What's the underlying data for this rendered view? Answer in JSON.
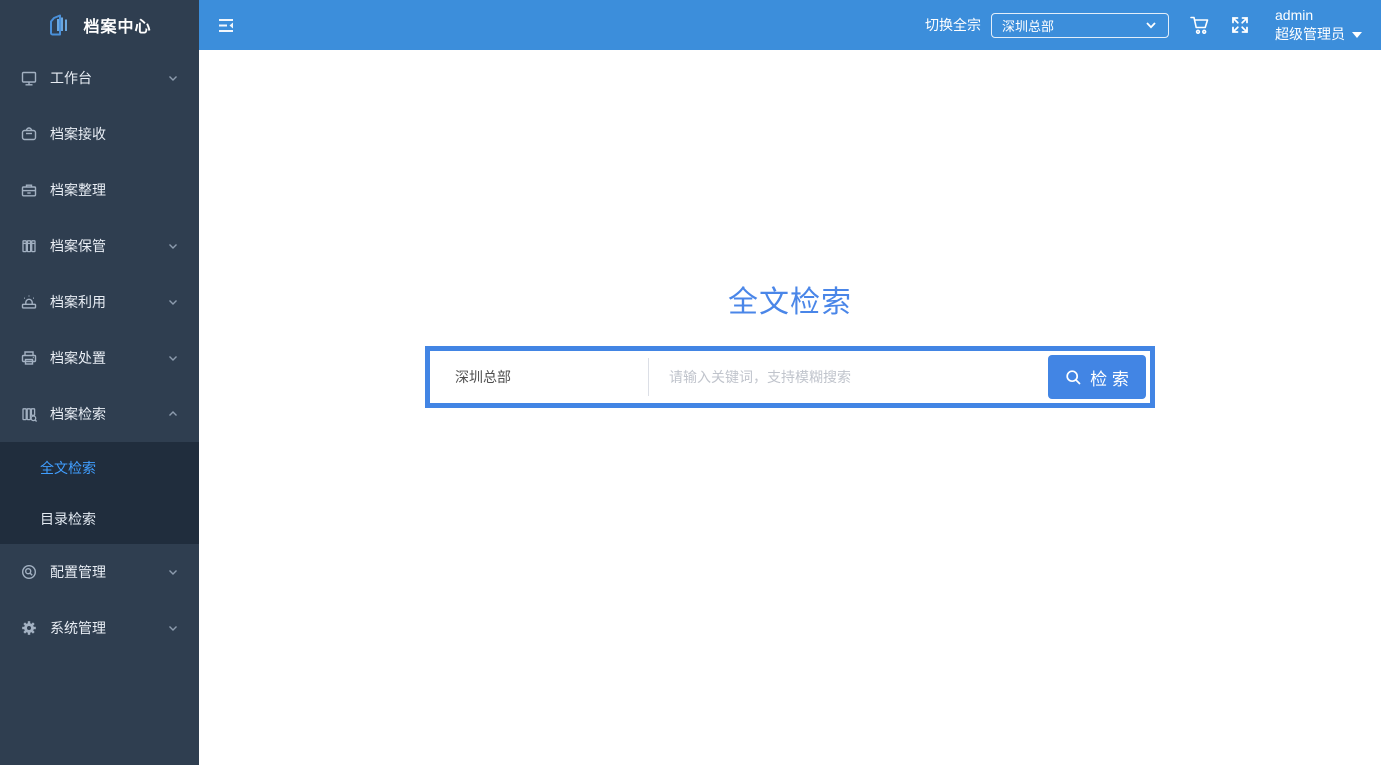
{
  "app": {
    "title": "档案中心"
  },
  "topbar": {
    "fonds_switch_label": "切换全宗",
    "fonds_selected": "深圳总部",
    "user_name": "admin",
    "user_role": "超级管理员",
    "icons": [
      "menu-fold-icon",
      "cart-icon",
      "fullscreen-icon",
      "caret-down-icon",
      "chevron-down-icon"
    ]
  },
  "sidebar": {
    "items": [
      {
        "label": "工作台",
        "icon": "monitor-icon",
        "expandable": true,
        "expanded": false
      },
      {
        "label": "档案接收",
        "icon": "inbox-bag-icon",
        "expandable": false,
        "expanded": false
      },
      {
        "label": "档案整理",
        "icon": "toolbox-icon",
        "expandable": false,
        "expanded": false
      },
      {
        "label": "档案保管",
        "icon": "books-icon",
        "expandable": true,
        "expanded": false
      },
      {
        "label": "档案利用",
        "icon": "stamp-icon",
        "expandable": true,
        "expanded": false
      },
      {
        "label": "档案处置",
        "icon": "printer-icon",
        "expandable": true,
        "expanded": false
      },
      {
        "label": "档案检索",
        "icon": "books-search-icon",
        "expandable": true,
        "expanded": true
      },
      {
        "label": "配置管理",
        "icon": "gear-search-icon",
        "expandable": true,
        "expanded": false
      },
      {
        "label": "系统管理",
        "icon": "gear-icon",
        "expandable": true,
        "expanded": false
      }
    ],
    "submenu_of": "档案检索",
    "submenu": [
      {
        "label": "全文检索",
        "active": true
      },
      {
        "label": "目录检索",
        "active": false
      }
    ]
  },
  "main": {
    "title": "全文检索",
    "search": {
      "scope_selected": "深圳总部",
      "placeholder": "请输入关键词，支持模糊搜索",
      "button_label": "检 索",
      "button_icon": "search-icon"
    }
  },
  "colors": {
    "topbar_bg": "#3c8edb",
    "sidebar_bg": "#2f3e50",
    "submenu_bg": "#202d3d",
    "accent_blue": "#4285e4",
    "title_blue": "#4a86e8",
    "active_menu_blue": "#409eff",
    "icon_gray": "#a3b1c2",
    "placeholder_gray": "#c0c4cc"
  }
}
